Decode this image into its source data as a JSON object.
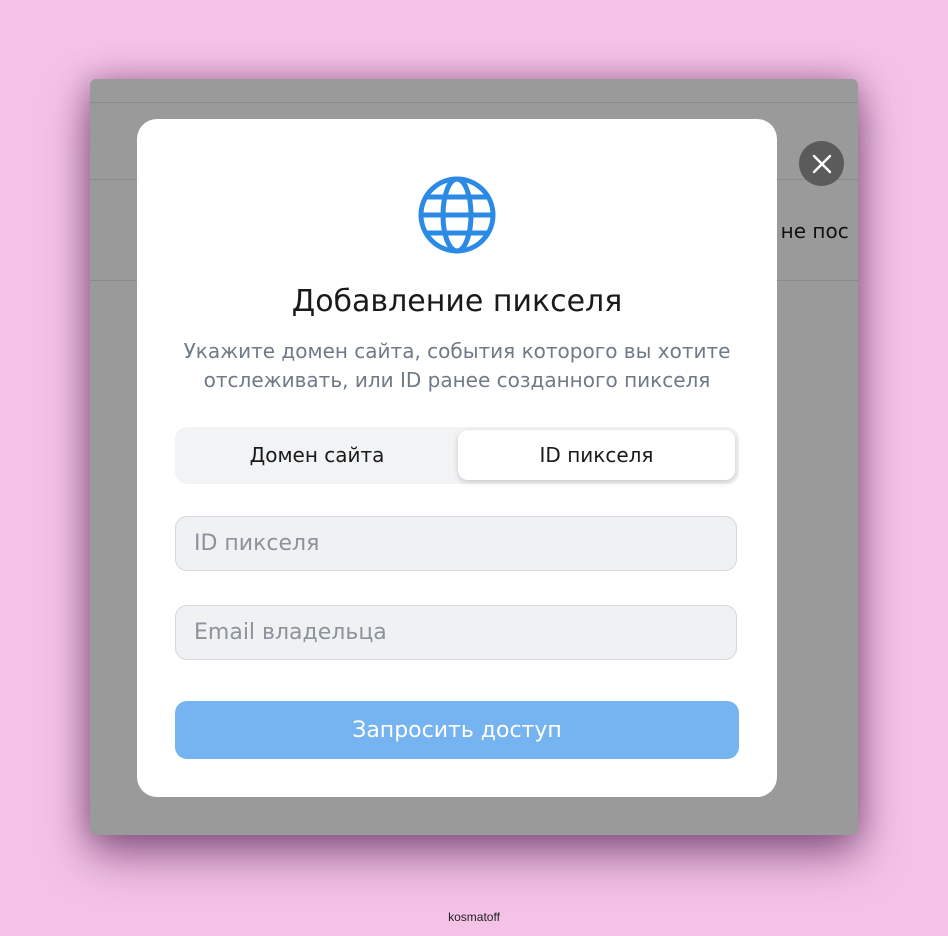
{
  "background": {
    "partial_text": "е не пос"
  },
  "close_icon": "close-icon",
  "modal": {
    "icon": "globe-icon",
    "title": "Добавление пикселя",
    "subtitle_line1": "Укажите домен сайта, события которого вы хотите",
    "subtitle_line2": "отслеживать, или ID ранее созданного пикселя",
    "tabs": [
      {
        "label": "Домен сайта",
        "selected": false
      },
      {
        "label": "ID пикселя",
        "selected": true
      }
    ],
    "fields": {
      "pixel_id": {
        "placeholder": "ID пикселя",
        "value": ""
      },
      "owner_email": {
        "placeholder": "Email владельца",
        "value": ""
      }
    },
    "submit_label": "Запросить доступ"
  },
  "footer_text": "kosmatoff",
  "colors": {
    "accent": "#2b8ae6",
    "submit_disabled": "#75b4f0",
    "page_background": "#f4c2e7"
  }
}
